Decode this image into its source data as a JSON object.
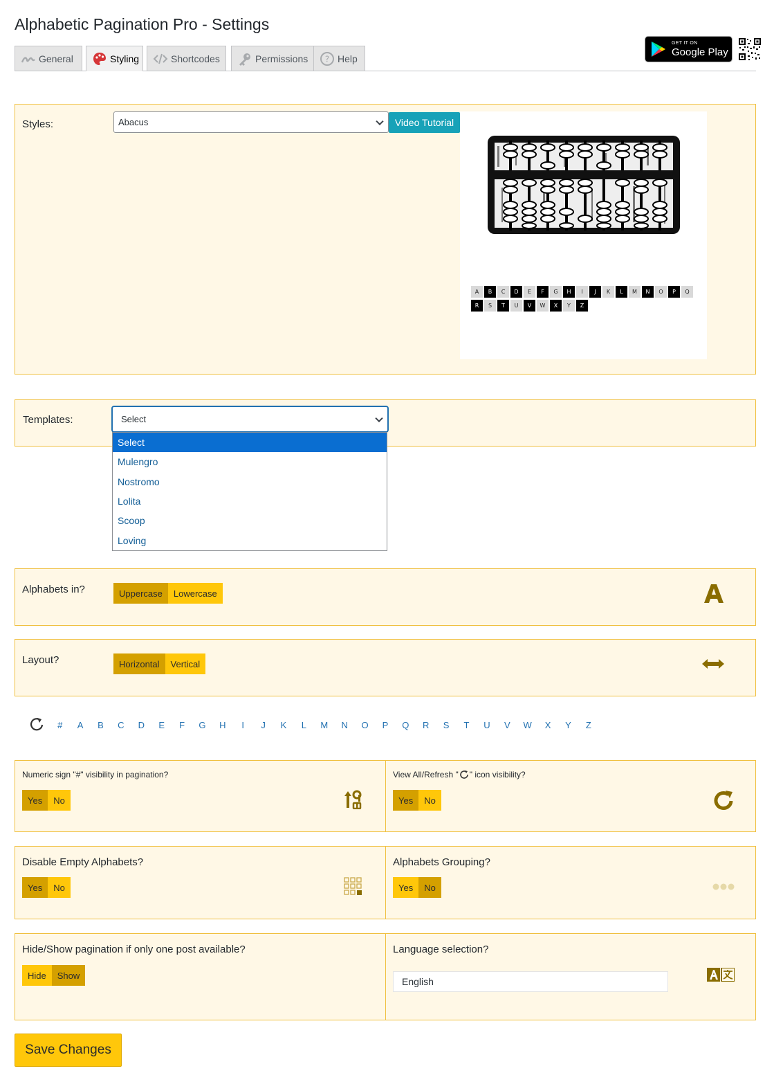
{
  "page": {
    "title": "Alphabetic Pagination Pro - Settings"
  },
  "tabs": [
    {
      "label": "General",
      "icon": "signature-icon"
    },
    {
      "label": "Styling",
      "icon": "palette-icon"
    },
    {
      "label": "Shortcodes",
      "icon": "code-icon"
    },
    {
      "label": "Permissions",
      "icon": "key-icon"
    },
    {
      "label": "Help",
      "icon": "help-icon"
    }
  ],
  "badge": {
    "small": "GET IT ON",
    "big": "Google Play"
  },
  "styles": {
    "label": "Styles:",
    "selected": "Abacus",
    "video_button": "Video Tutorial",
    "preview_rows": [
      [
        "A",
        "B",
        "C",
        "D",
        "E",
        "F",
        "G",
        "H",
        "I",
        "J",
        "K",
        "L",
        "M",
        "N",
        "O",
        "P",
        "Q"
      ],
      [
        "R",
        "S",
        "T",
        "U",
        "V",
        "W",
        "X",
        "Y",
        "Z"
      ]
    ]
  },
  "templates": {
    "label": "Templates:",
    "selected": "Select",
    "options": [
      "Select",
      "Mulengro",
      "Nostromo",
      "Lolita",
      "Scoop",
      "Loving"
    ]
  },
  "alphabets_case": {
    "label": "Alphabets in?",
    "options": [
      "Uppercase",
      "Lowercase"
    ],
    "active": "Uppercase"
  },
  "layout": {
    "label": "Layout?",
    "options": [
      "Horizontal",
      "Vertical"
    ],
    "active": "Horizontal"
  },
  "alpha_nav": [
    "#",
    "A",
    "B",
    "C",
    "D",
    "E",
    "F",
    "G",
    "H",
    "I",
    "J",
    "K",
    "L",
    "M",
    "N",
    "O",
    "P",
    "Q",
    "R",
    "S",
    "T",
    "U",
    "V",
    "W",
    "X",
    "Y",
    "Z"
  ],
  "numeric_sign": {
    "label": "Numeric sign \"#\" visibility in pagination?",
    "options": [
      "Yes",
      "No"
    ],
    "active": "Yes"
  },
  "view_all": {
    "label_before": "View All/Refresh \"",
    "label_after": "\" icon visibility?",
    "options": [
      "Yes",
      "No"
    ],
    "active": "Yes"
  },
  "disable_empty": {
    "label": "Disable Empty Alphabets?",
    "options": [
      "Yes",
      "No"
    ],
    "active": "Yes"
  },
  "grouping": {
    "label": "Alphabets Grouping?",
    "options": [
      "Yes",
      "No"
    ],
    "active": "No"
  },
  "hide_show": {
    "label": "Hide/Show pagination if only one post available?",
    "options": [
      "Hide",
      "Show"
    ],
    "active": "Show"
  },
  "language": {
    "label": "Language selection?",
    "value": "English"
  },
  "save_button": "Save Changes",
  "colors": {
    "panel_bg": "#fff8e6",
    "panel_border": "#f0c040",
    "toggle": "#ffc70a",
    "toggle_active": "#d4a000",
    "icon": "#8a6d00",
    "video_button": "#17a2b8",
    "link": "#2271b1"
  }
}
